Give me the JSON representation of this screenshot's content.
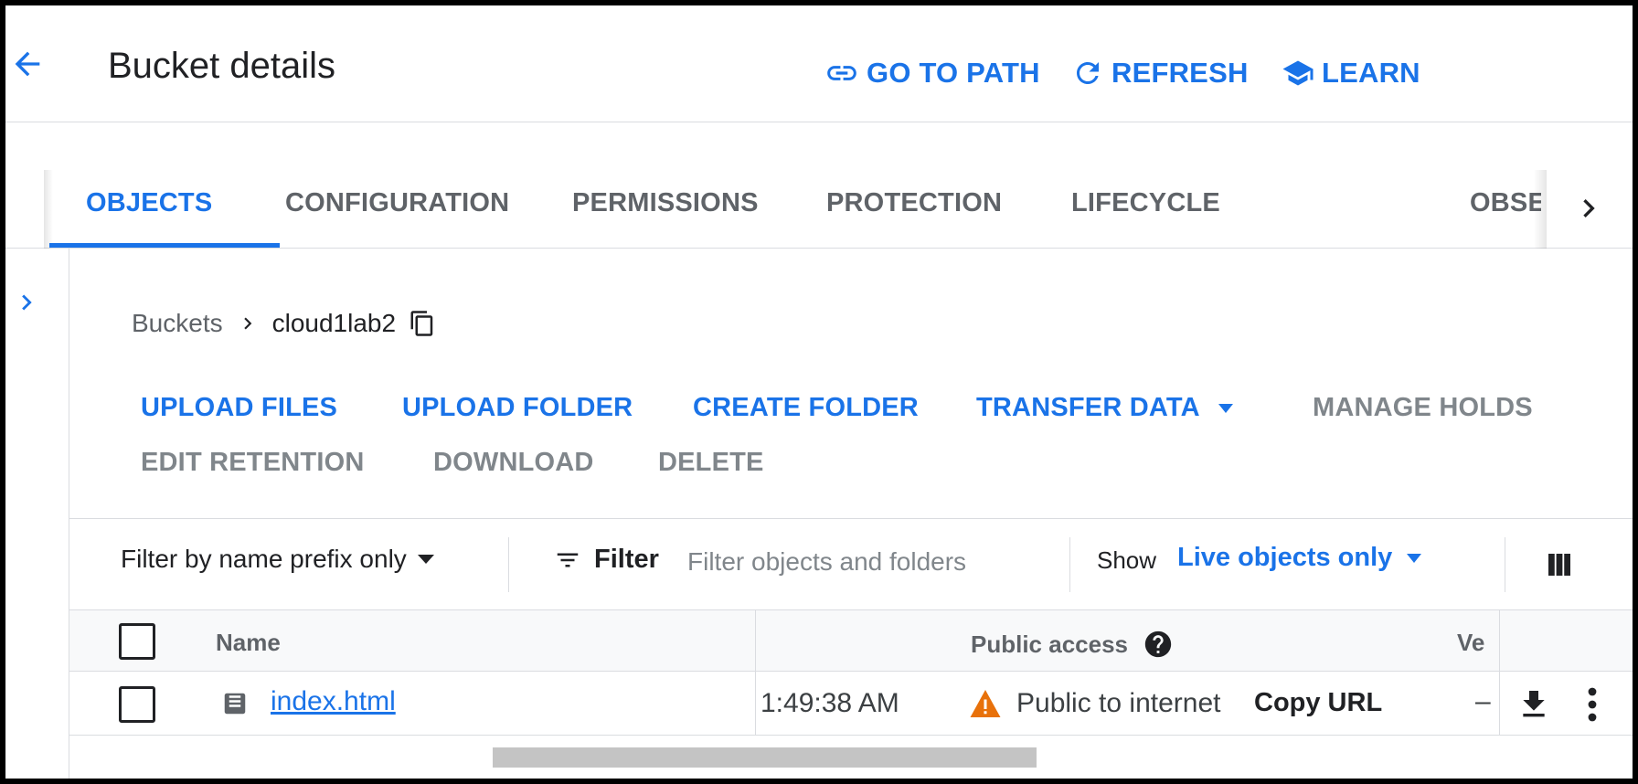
{
  "header": {
    "title": "Bucket details",
    "actions": [
      {
        "label": "GO TO PATH",
        "icon": "link-icon"
      },
      {
        "label": "REFRESH",
        "icon": "refresh-icon"
      },
      {
        "label": "LEARN",
        "icon": "school-icon"
      }
    ]
  },
  "tabs": {
    "items": [
      {
        "label": "OBJECTS",
        "active": true
      },
      {
        "label": "CONFIGURATION"
      },
      {
        "label": "PERMISSIONS"
      },
      {
        "label": "PROTECTION"
      },
      {
        "label": "LIFECYCLE"
      },
      {
        "label": "OBSE"
      }
    ]
  },
  "breadcrumb": {
    "root": "Buckets",
    "current": "cloud1lab2"
  },
  "actions": {
    "upload_files": "UPLOAD FILES",
    "upload_folder": "UPLOAD FOLDER",
    "create_folder": "CREATE FOLDER",
    "transfer_data": "TRANSFER DATA",
    "manage_holds": "MANAGE HOLDS",
    "edit_retention": "EDIT RETENTION",
    "download": "DOWNLOAD",
    "delete": "DELETE"
  },
  "toolbar": {
    "prefix_select": "Filter by name prefix only",
    "filter_label": "Filter",
    "filter_placeholder": "Filter objects and folders",
    "show_label": "Show",
    "show_value": "Live objects only"
  },
  "table": {
    "headers": {
      "name": "Name",
      "public_access": "Public access",
      "version": "Ve"
    },
    "rows": [
      {
        "name": "index.html",
        "time": "1:49:38 AM",
        "public_access": "Public to internet",
        "copy_url": "Copy URL",
        "version": "–"
      }
    ]
  },
  "colors": {
    "accent": "#1a73e8",
    "warning": "#e8710a",
    "disabled": "#80868b"
  }
}
